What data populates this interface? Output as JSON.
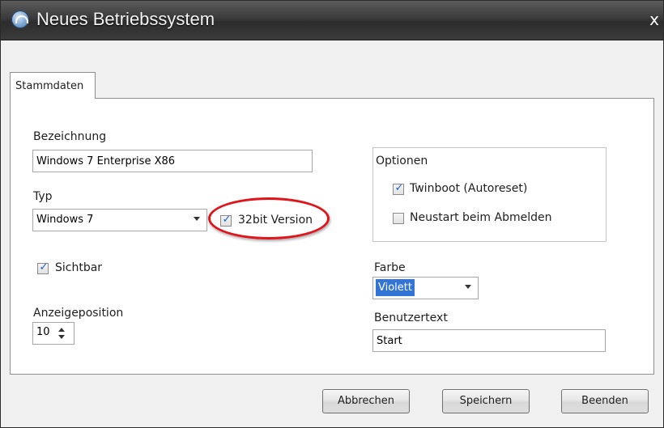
{
  "window": {
    "title": "Neues Betriebssystem",
    "close_glyph": "x"
  },
  "tabs": [
    {
      "label": "Stammdaten",
      "active": true
    }
  ],
  "form": {
    "bezeichnung_label": "Bezeichnung",
    "bezeichnung_value": "Windows 7 Enterprise X86",
    "typ_label": "Typ",
    "typ_value": "Windows 7",
    "bit32_label": "32bit Version",
    "bit32_checked": true,
    "sichtbar_label": "Sichtbar",
    "sichtbar_checked": true,
    "anzeigeposition_label": "Anzeigeposition",
    "anzeigeposition_value": "10",
    "optionen_label": "Optionen",
    "twinboot_label": "Twinboot (Autoreset)",
    "twinboot_checked": true,
    "neustart_label": "Neustart beim Abmelden",
    "neustart_checked": false,
    "farbe_label": "Farbe",
    "farbe_value": "Violett",
    "benutzertext_label": "Benutzertext",
    "benutzertext_value": "Start"
  },
  "buttons": {
    "abbrechen": "Abbrechen",
    "speichern": "Speichern",
    "beenden": "Beenden"
  },
  "colors": {
    "titlebar": "#3a3a3a",
    "annotation_oval": "#e0151c",
    "selection": "#3375d6",
    "check": "#1b5ec9"
  },
  "icons": {
    "app": "orbit-logo-icon",
    "close": "close-icon",
    "dropdown": "chevron-down-icon",
    "spinner": "spin-arrows-icon"
  }
}
